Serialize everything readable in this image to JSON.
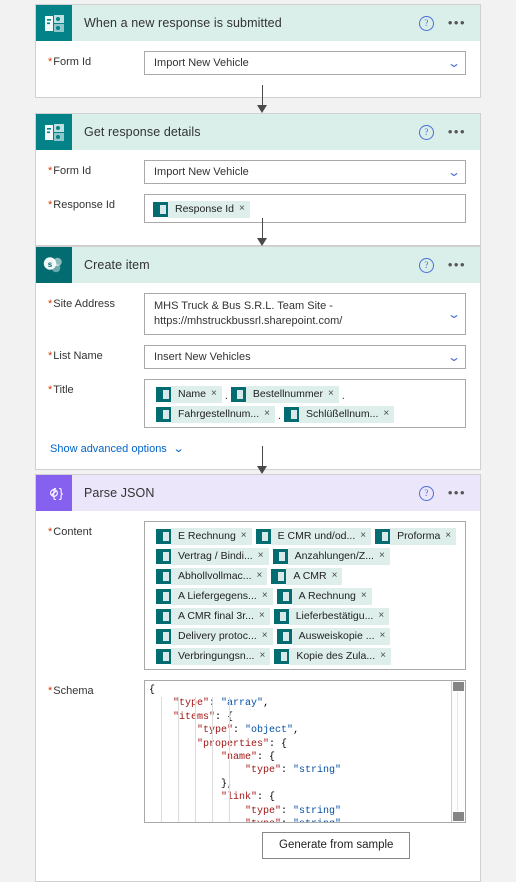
{
  "app": {
    "name": "Power Automate flow designer"
  },
  "icons": {
    "help": "help-circle-icon",
    "more": "ellipsis-icon",
    "chevron": "chevron-down-icon"
  },
  "glyphs": {
    "help": "?",
    "ellipsis": "•••",
    "chevron": "⌄",
    "close": "×",
    "sp_letter": "s",
    "json_brace": "{⊘}"
  },
  "colors": {
    "forms_teal": "#038387",
    "sharepoint_teal": "#036c70",
    "json_purple": "#8661f0",
    "header_teal_tint": "#daeeea",
    "header_purple_tint": "#ece6fb",
    "token_chip": "#ddeeeb",
    "required_asterisk": "#d83b01",
    "link_blue": "#0264c8",
    "json_key": "#a31515",
    "json_value": "#0451a5"
  },
  "cards": [
    {
      "id": "trigger",
      "title": "When a new response is submitted",
      "connector": "microsoft-forms",
      "fields": [
        {
          "label": "Form Id",
          "required": true,
          "type": "dropdown",
          "value": "Import New Vehicle"
        }
      ]
    },
    {
      "id": "get-response-details",
      "title": "Get response details",
      "connector": "microsoft-forms",
      "fields": [
        {
          "label": "Form Id",
          "required": true,
          "type": "dropdown",
          "value": "Import New Vehicle"
        },
        {
          "label": "Response Id",
          "required": true,
          "type": "tokens",
          "tokens": [
            {
              "text": "Response Id"
            }
          ]
        }
      ]
    },
    {
      "id": "create-item",
      "title": "Create item",
      "connector": "sharepoint",
      "fields": [
        {
          "label": "Site Address",
          "required": true,
          "type": "dropdown-2line",
          "value_line1": "MHS Truck &  Bus S.R.L. Team Site -",
          "value_line2": "https://mhstruckbussrl.sharepoint.com/"
        },
        {
          "label": "List Name",
          "required": true,
          "type": "dropdown",
          "value": "Insert New Vehicles"
        },
        {
          "label": "Title",
          "required": true,
          "type": "tokens",
          "tokens": [
            {
              "text": "Name",
              "sep": "."
            },
            {
              "text": "Bestellnummer",
              "sep": "."
            },
            {
              "text": "Fahrgestellnum...",
              "sep": "."
            },
            {
              "text": "Schlüßellnum..."
            }
          ]
        }
      ],
      "advanced_options_label": "Show advanced options"
    },
    {
      "id": "parse-json",
      "title": "Parse JSON",
      "connector": "data-operations",
      "fields": [
        {
          "label": "Content",
          "required": true,
          "type": "tokens",
          "tokens": [
            {
              "text": "E Rechnung"
            },
            {
              "text": "E CMR und/od..."
            },
            {
              "text": "Proforma"
            },
            {
              "text": "Vertrag / Bindi..."
            },
            {
              "text": "Anzahlungen/Z..."
            },
            {
              "text": "Abhollvollmac..."
            },
            {
              "text": "A CMR"
            },
            {
              "text": "A Liefergegens..."
            },
            {
              "text": "A Rechnung"
            },
            {
              "text": "A CMR final 3r..."
            },
            {
              "text": "Lieferbestätigu..."
            },
            {
              "text": "Delivery protoc..."
            },
            {
              "text": "Ausweiskopie ..."
            },
            {
              "text": "Verbringungsn..."
            },
            {
              "text": "Kopie des Zula..."
            }
          ]
        },
        {
          "label": "Schema",
          "required": true,
          "type": "code"
        }
      ],
      "generate_button_label": "Generate from sample"
    }
  ],
  "schema_code": {
    "lines": [
      {
        "indent": 0,
        "parts": [
          {
            "t": "{",
            "c": "p"
          }
        ]
      },
      {
        "indent": 1,
        "parts": [
          {
            "t": "\"type\"",
            "c": "k"
          },
          {
            "t": ": ",
            "c": "p"
          },
          {
            "t": "\"array\"",
            "c": "v"
          },
          {
            "t": ",",
            "c": "p"
          }
        ]
      },
      {
        "indent": 1,
        "parts": [
          {
            "t": "\"items\"",
            "c": "k"
          },
          {
            "t": ": {",
            "c": "p"
          }
        ]
      },
      {
        "indent": 2,
        "parts": [
          {
            "t": "\"type\"",
            "c": "k"
          },
          {
            "t": ": ",
            "c": "p"
          },
          {
            "t": "\"object\"",
            "c": "v"
          },
          {
            "t": ",",
            "c": "p"
          }
        ]
      },
      {
        "indent": 2,
        "parts": [
          {
            "t": "\"properties\"",
            "c": "k"
          },
          {
            "t": ": {",
            "c": "p"
          }
        ]
      },
      {
        "indent": 3,
        "parts": [
          {
            "t": "\"name\"",
            "c": "k"
          },
          {
            "t": ": {",
            "c": "p"
          }
        ]
      },
      {
        "indent": 4,
        "parts": [
          {
            "t": "\"type\"",
            "c": "k"
          },
          {
            "t": ": ",
            "c": "p"
          },
          {
            "t": "\"string\"",
            "c": "v"
          }
        ]
      },
      {
        "indent": 3,
        "parts": [
          {
            "t": "},",
            "c": "p"
          }
        ]
      },
      {
        "indent": 3,
        "parts": [
          {
            "t": "\"link\"",
            "c": "k"
          },
          {
            "t": ": {",
            "c": "p"
          }
        ]
      },
      {
        "indent": 4,
        "parts": [
          {
            "t": "\"type\"",
            "c": "k"
          },
          {
            "t": ": ",
            "c": "p"
          },
          {
            "t": "\"string\"",
            "c": "v"
          }
        ]
      },
      {
        "indent": 4,
        "parts": [
          {
            "t": "\"type\"",
            "c": "k"
          },
          {
            "t": ": ",
            "c": "p"
          },
          {
            "t": "\"string\"",
            "c": "v"
          }
        ]
      }
    ]
  }
}
